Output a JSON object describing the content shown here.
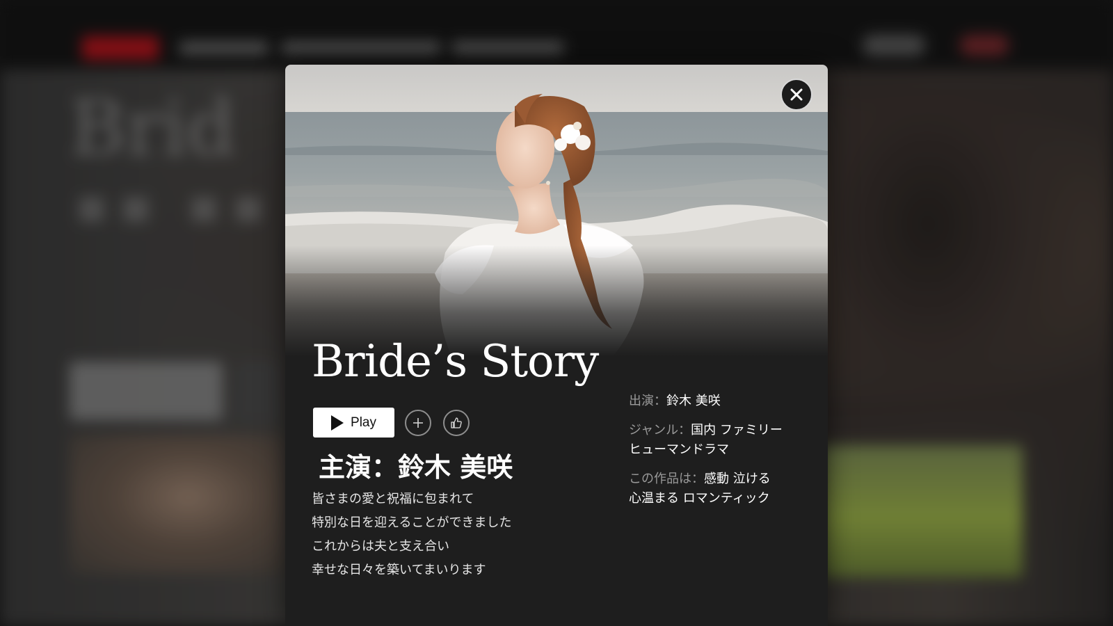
{
  "modal": {
    "title": "Bride’s Story",
    "play_label": "Play",
    "add_icon": "plus-icon",
    "like_icon": "thumbs-up-icon",
    "close_icon": "close-icon",
    "starring": "主演：鈴木 美咲",
    "description": [
      "皆さまの愛と祝福に包まれて",
      "特別な日を迎えることができました",
      "これからは夫と支え合い",
      "幸せな日々を築いてまいります"
    ],
    "meta": {
      "cast_label": "出演：",
      "cast_value": "鈴木 美咲",
      "genre_label": "ジャンル：",
      "genre_value_1": "国内 ファミリー",
      "genre_value_2": "ヒューマンドラマ",
      "mood_label": "この作品は：",
      "mood_value_1": "感動 泣ける",
      "mood_value_2": "心温まる ロマンティック"
    }
  },
  "colors": {
    "modal_bg": "#1e1e1e",
    "brand_red": "#b3151d",
    "text_primary": "#ffffff",
    "text_muted": "#9a9a9a"
  }
}
